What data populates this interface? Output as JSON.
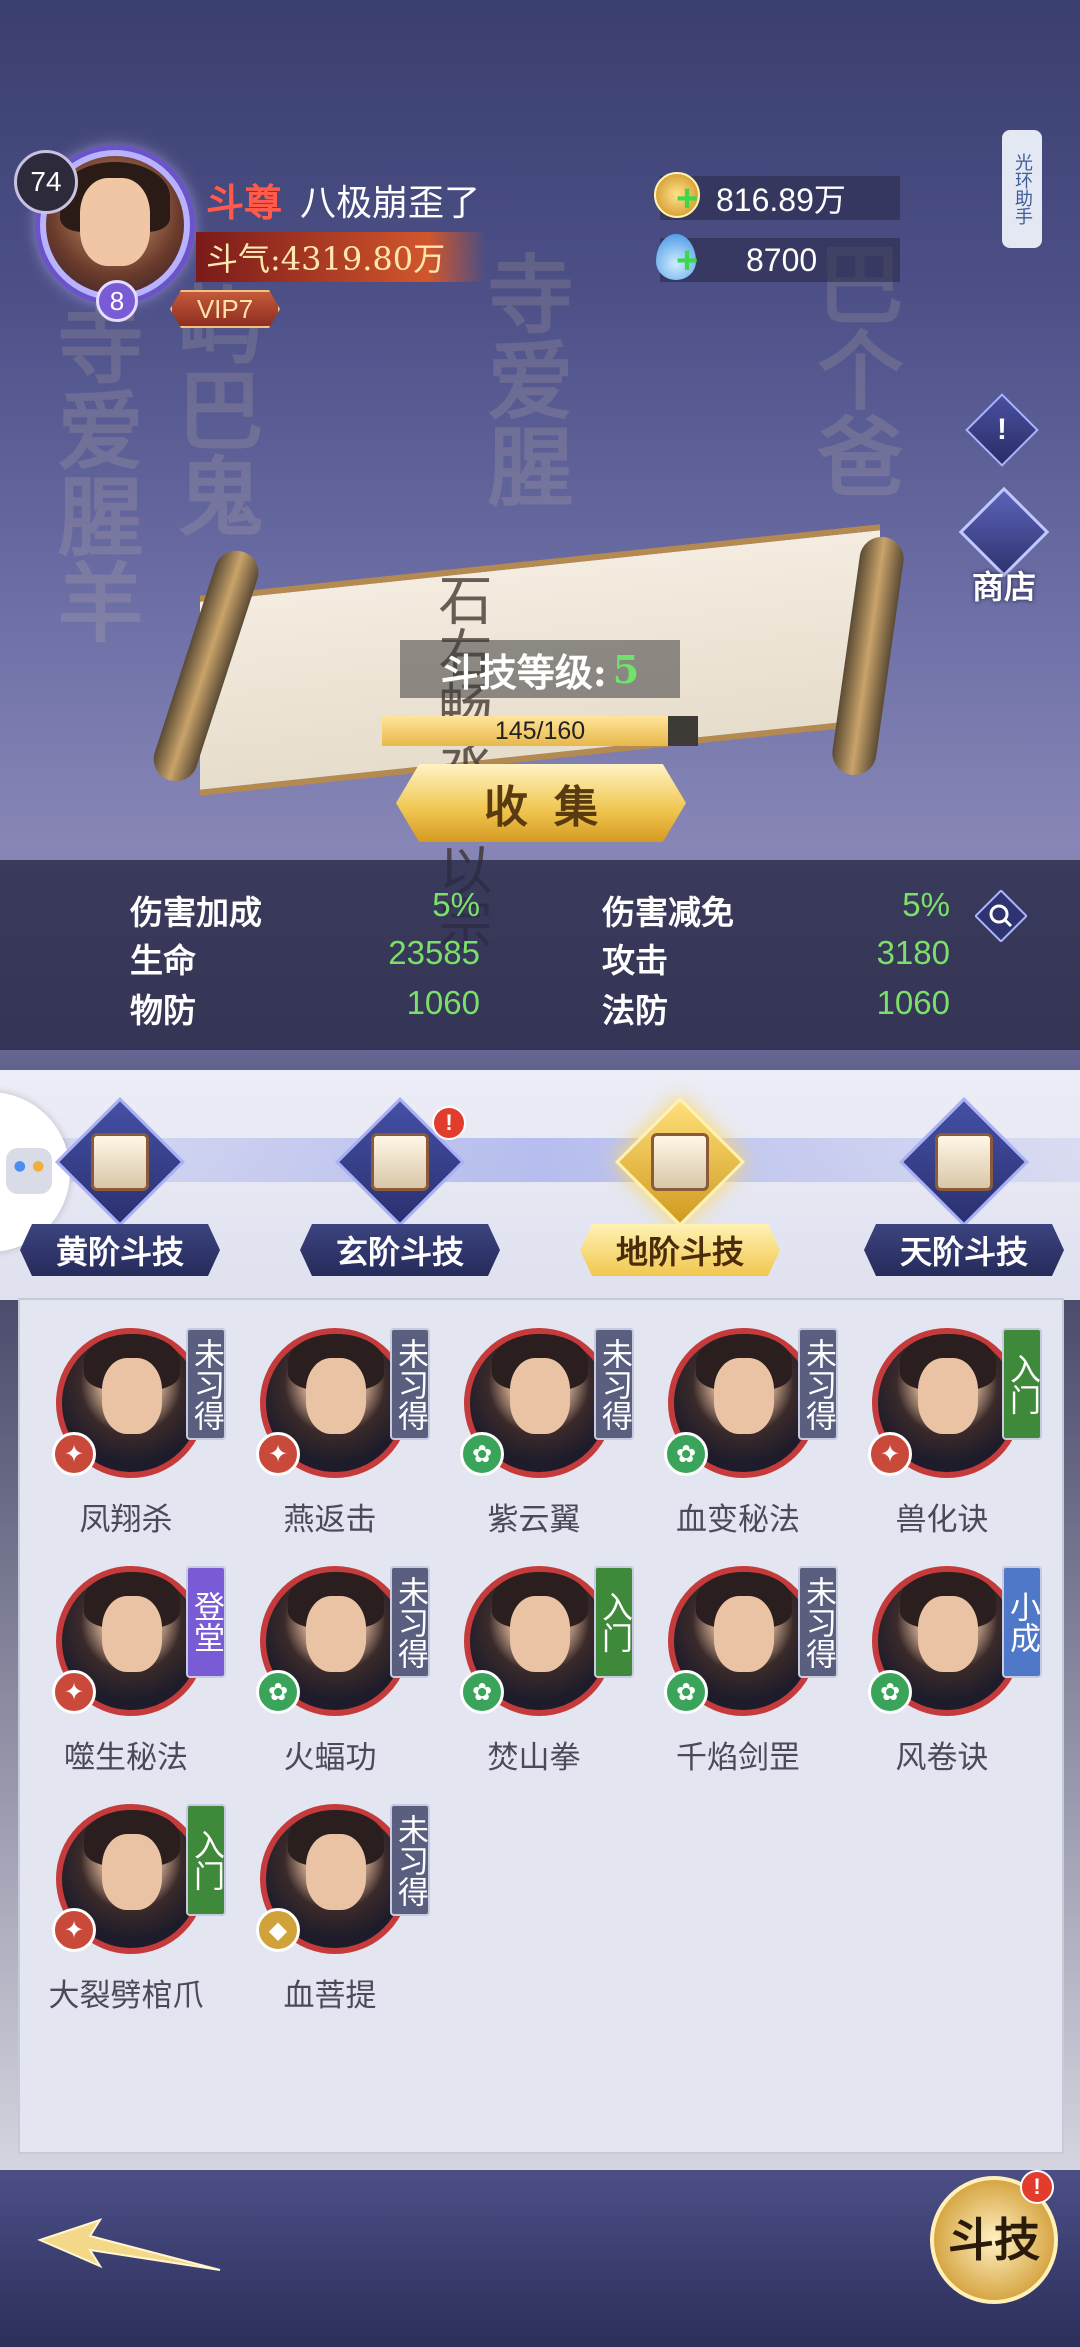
{
  "player": {
    "level": "74",
    "rank": "斗尊",
    "name": "八极崩歪了",
    "power_label": "斗气:4319.80万",
    "star": "8",
    "vip": "VIP7"
  },
  "currency": {
    "gold": "816.89万",
    "soul": "8700"
  },
  "side": {
    "helper": "光环助手",
    "info": "!",
    "shop": "商店"
  },
  "scroll": {
    "ink": "石右畅丞吞以宗",
    "level_label": "斗技等级:",
    "level_value": "5",
    "progress_text": "145/160",
    "progress_fraction": 0.906,
    "collect": "收集"
  },
  "stats": [
    {
      "k": "伤害加成",
      "v": "5%"
    },
    {
      "k": "伤害减免",
      "v": "5%"
    },
    {
      "k": "生命",
      "v": "23585"
    },
    {
      "k": "攻击",
      "v": "3180"
    },
    {
      "k": "物防",
      "v": "1060"
    },
    {
      "k": "法防",
      "v": "1060"
    }
  ],
  "tabs": [
    {
      "label": "黄阶斗技"
    },
    {
      "label": "玄阶斗技",
      "alert": "!"
    },
    {
      "label": "地阶斗技"
    },
    {
      "label": "天阶斗技"
    }
  ],
  "skills": [
    {
      "name": "凤翔杀",
      "status": "未习得"
    },
    {
      "name": "燕返击",
      "status": "未习得"
    },
    {
      "name": "紫云翼",
      "status": "未习得"
    },
    {
      "name": "血变秘法",
      "status": "未习得"
    },
    {
      "name": "兽化诀",
      "status": "入门"
    },
    {
      "name": "噬生秘法",
      "status": "登堂"
    },
    {
      "name": "火蝠功",
      "status": "未习得"
    },
    {
      "name": "焚山拳",
      "status": "入门"
    },
    {
      "name": "千焰剑罡",
      "status": "未习得"
    },
    {
      "name": "风卷诀",
      "status": "小成"
    },
    {
      "name": "大裂劈棺爪",
      "status": "入门"
    },
    {
      "name": "血菩提",
      "status": "未习得"
    }
  ],
  "bottom": {
    "fight": "斗技",
    "fight_alert": "!"
  },
  "colors": {
    "accent_green": "#79e068",
    "rank_red": "#ff5a4a",
    "gold": "#f0c54e"
  }
}
